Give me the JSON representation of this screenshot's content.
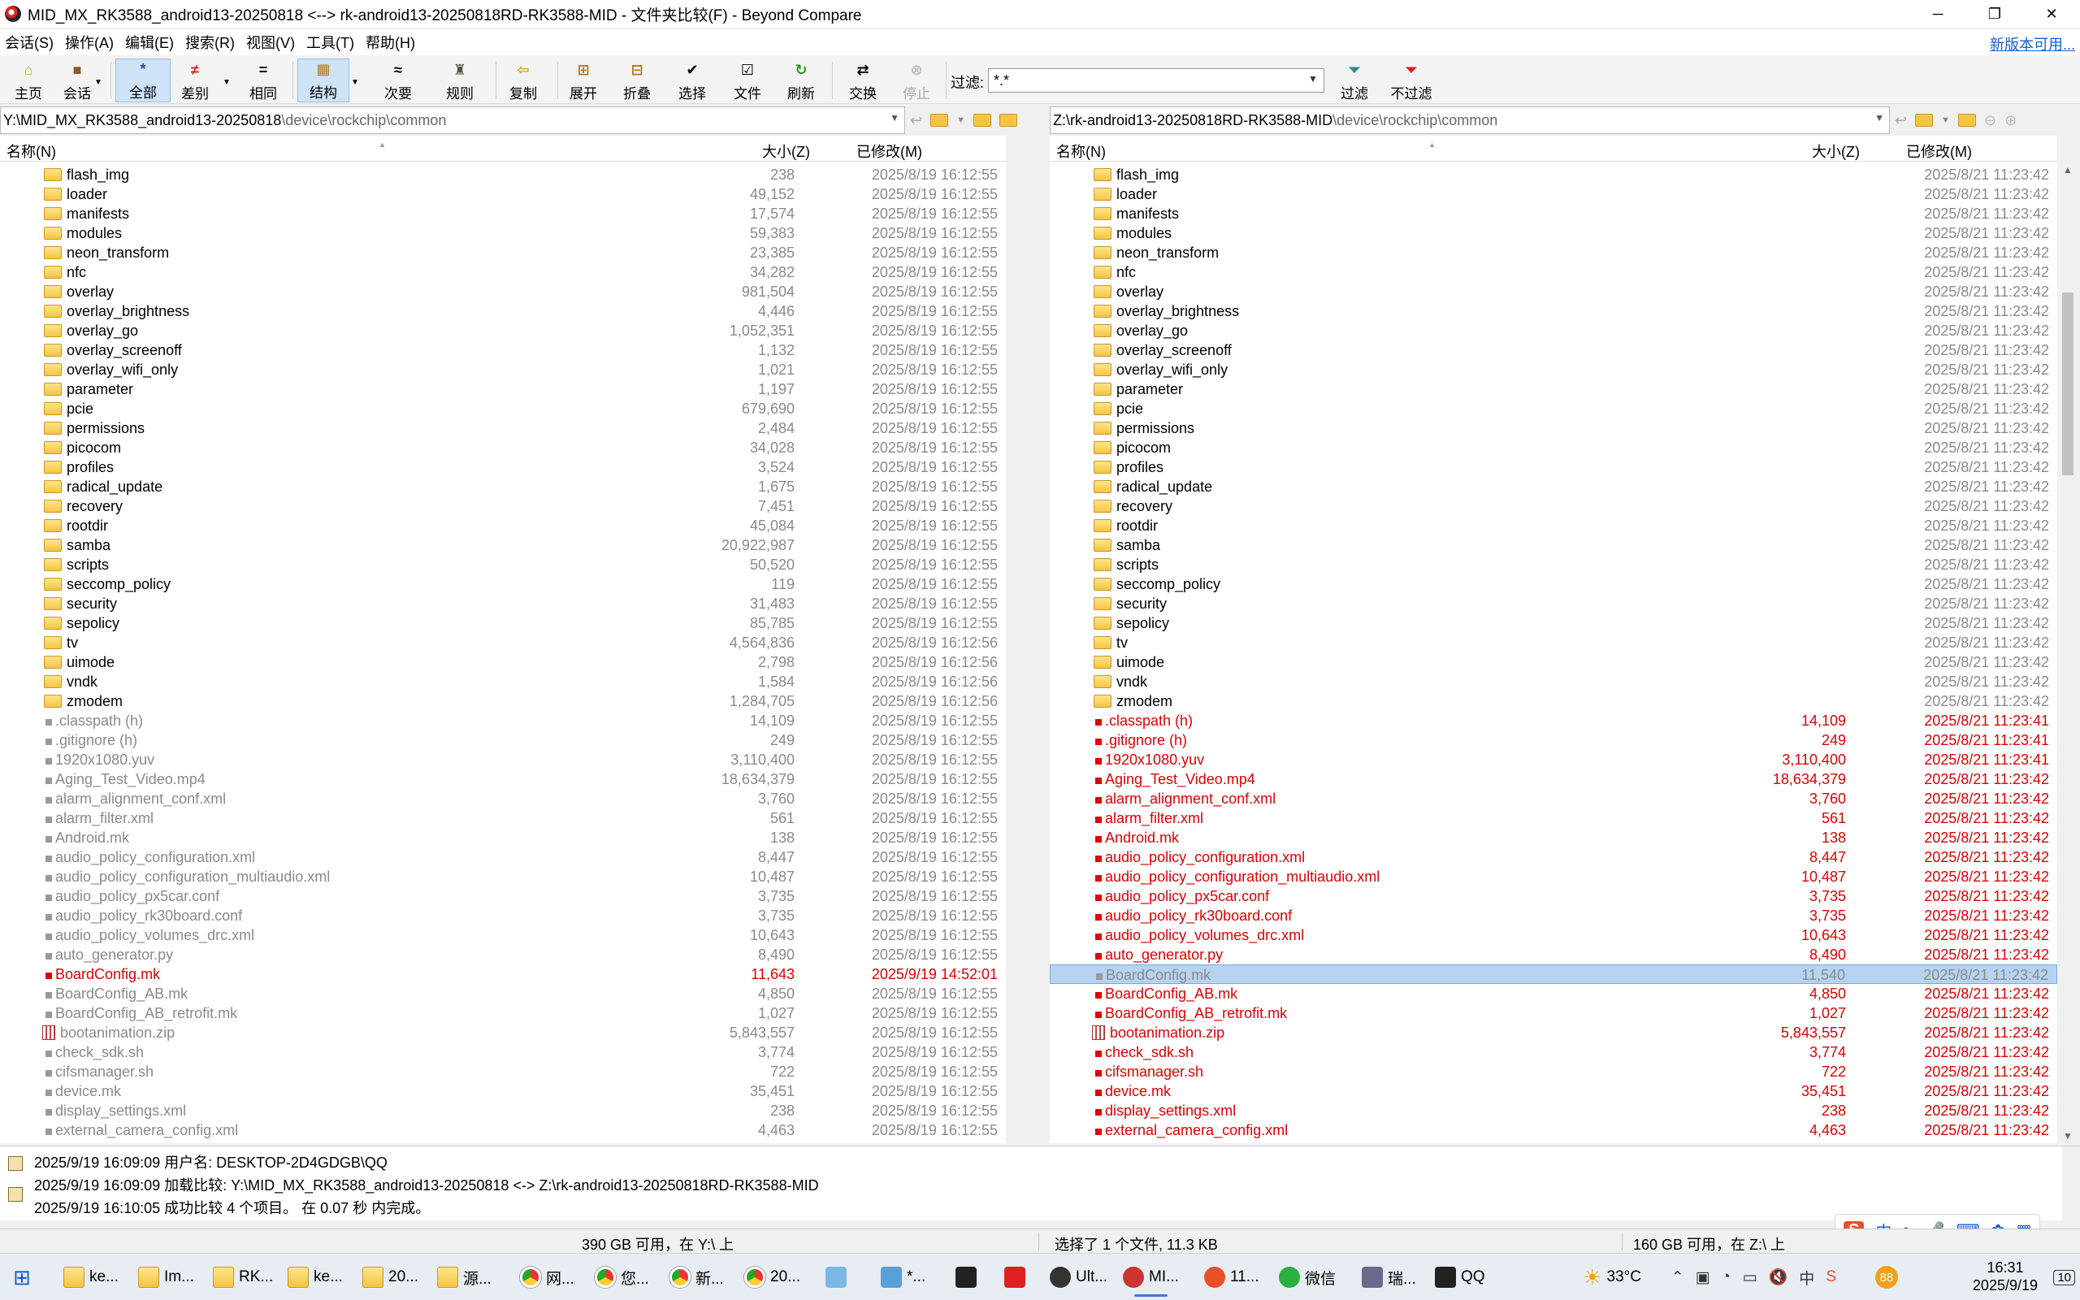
{
  "window": {
    "title": "MID_MX_RK3588_android13-20250818 <--> rk-android13-20250818RD-RK3588-MID - 文件夹比较(F) - Beyond Compare",
    "minimize": "─",
    "maximize": "❐",
    "close": "✕"
  },
  "menu": {
    "items": [
      "会话(S)",
      "操作(A)",
      "编辑(E)",
      "搜索(R)",
      "视图(V)",
      "工具(T)",
      "帮助(H)"
    ],
    "new_version": "新版本可用..."
  },
  "toolbar": {
    "home": "主页",
    "session": "会话",
    "all": "全部",
    "diffs": "差别",
    "same": "相同",
    "structure": "结构",
    "minor": "次要",
    "rules": "规则",
    "copy": "复制",
    "expand": "展开",
    "collapse": "折叠",
    "select": "选择",
    "files": "文件",
    "refresh": "刷新",
    "swap": "交换",
    "stop": "停止",
    "filter_label": "过滤:",
    "filter_value": "*.*",
    "filters": "过滤",
    "no_filter": "不过滤"
  },
  "left": {
    "path_main": "Y:\\MID_MX_RK3588_android13-20250818",
    "path_sub": "\\device\\rockchip\\common",
    "col_name": "名称(N)",
    "col_size": "大小(Z)",
    "col_modified": "已修改(M)"
  },
  "right": {
    "path_main": "Z:\\rk-android13-20250818RD-RK3588-MID",
    "path_sub": "\\device\\rockchip\\common",
    "col_name": "名称(N)",
    "col_size": "大小(Z)",
    "col_modified": "已修改(M)"
  },
  "rows": [
    {
      "name": "flash_img",
      "type": "folder",
      "lsize": "238",
      "ldate": "2025/8/19 16:12:55",
      "rsize": "",
      "rdate": "2025/8/21 11:23:42",
      "lstate": "same",
      "rstate": "same"
    },
    {
      "name": "loader",
      "type": "folder",
      "lsize": "49,152",
      "ldate": "2025/8/19 16:12:55",
      "rsize": "",
      "rdate": "2025/8/21 11:23:42",
      "lstate": "same",
      "rstate": "same"
    },
    {
      "name": "manifests",
      "type": "folder",
      "lsize": "17,574",
      "ldate": "2025/8/19 16:12:55",
      "rsize": "",
      "rdate": "2025/8/21 11:23:42",
      "lstate": "same",
      "rstate": "same"
    },
    {
      "name": "modules",
      "type": "folder",
      "lsize": "59,383",
      "ldate": "2025/8/19 16:12:55",
      "rsize": "",
      "rdate": "2025/8/21 11:23:42",
      "lstate": "same",
      "rstate": "same"
    },
    {
      "name": "neon_transform",
      "type": "folder",
      "lsize": "23,385",
      "ldate": "2025/8/19 16:12:55",
      "rsize": "",
      "rdate": "2025/8/21 11:23:42",
      "lstate": "same",
      "rstate": "same"
    },
    {
      "name": "nfc",
      "type": "folder",
      "lsize": "34,282",
      "ldate": "2025/8/19 16:12:55",
      "rsize": "",
      "rdate": "2025/8/21 11:23:42",
      "lstate": "same",
      "rstate": "same"
    },
    {
      "name": "overlay",
      "type": "folder",
      "lsize": "981,504",
      "ldate": "2025/8/19 16:12:55",
      "rsize": "",
      "rdate": "2025/8/21 11:23:42",
      "lstate": "same",
      "rstate": "same"
    },
    {
      "name": "overlay_brightness",
      "type": "folder",
      "lsize": "4,446",
      "ldate": "2025/8/19 16:12:55",
      "rsize": "",
      "rdate": "2025/8/21 11:23:42",
      "lstate": "same",
      "rstate": "same"
    },
    {
      "name": "overlay_go",
      "type": "folder",
      "lsize": "1,052,351",
      "ldate": "2025/8/19 16:12:55",
      "rsize": "",
      "rdate": "2025/8/21 11:23:42",
      "lstate": "same",
      "rstate": "same"
    },
    {
      "name": "overlay_screenoff",
      "type": "folder",
      "lsize": "1,132",
      "ldate": "2025/8/19 16:12:55",
      "rsize": "",
      "rdate": "2025/8/21 11:23:42",
      "lstate": "same",
      "rstate": "same"
    },
    {
      "name": "overlay_wifi_only",
      "type": "folder",
      "lsize": "1,021",
      "ldate": "2025/8/19 16:12:55",
      "rsize": "",
      "rdate": "2025/8/21 11:23:42",
      "lstate": "same",
      "rstate": "same"
    },
    {
      "name": "parameter",
      "type": "folder",
      "lsize": "1,197",
      "ldate": "2025/8/19 16:12:55",
      "rsize": "",
      "rdate": "2025/8/21 11:23:42",
      "lstate": "same",
      "rstate": "same"
    },
    {
      "name": "pcie",
      "type": "folder",
      "lsize": "679,690",
      "ldate": "2025/8/19 16:12:55",
      "rsize": "",
      "rdate": "2025/8/21 11:23:42",
      "lstate": "same",
      "rstate": "same"
    },
    {
      "name": "permissions",
      "type": "folder",
      "lsize": "2,484",
      "ldate": "2025/8/19 16:12:55",
      "rsize": "",
      "rdate": "2025/8/21 11:23:42",
      "lstate": "same",
      "rstate": "same"
    },
    {
      "name": "picocom",
      "type": "folder",
      "lsize": "34,028",
      "ldate": "2025/8/19 16:12:55",
      "rsize": "",
      "rdate": "2025/8/21 11:23:42",
      "lstate": "same",
      "rstate": "same"
    },
    {
      "name": "profiles",
      "type": "folder",
      "lsize": "3,524",
      "ldate": "2025/8/19 16:12:55",
      "rsize": "",
      "rdate": "2025/8/21 11:23:42",
      "lstate": "same",
      "rstate": "same"
    },
    {
      "name": "radical_update",
      "type": "folder",
      "lsize": "1,675",
      "ldate": "2025/8/19 16:12:55",
      "rsize": "",
      "rdate": "2025/8/21 11:23:42",
      "lstate": "same",
      "rstate": "same"
    },
    {
      "name": "recovery",
      "type": "folder",
      "lsize": "7,451",
      "ldate": "2025/8/19 16:12:55",
      "rsize": "",
      "rdate": "2025/8/21 11:23:42",
      "lstate": "same",
      "rstate": "same"
    },
    {
      "name": "rootdir",
      "type": "folder",
      "lsize": "45,084",
      "ldate": "2025/8/19 16:12:55",
      "rsize": "",
      "rdate": "2025/8/21 11:23:42",
      "lstate": "same",
      "rstate": "same"
    },
    {
      "name": "samba",
      "type": "folder",
      "lsize": "20,922,987",
      "ldate": "2025/8/19 16:12:55",
      "rsize": "",
      "rdate": "2025/8/21 11:23:42",
      "lstate": "same",
      "rstate": "same"
    },
    {
      "name": "scripts",
      "type": "folder",
      "lsize": "50,520",
      "ldate": "2025/8/19 16:12:55",
      "rsize": "",
      "rdate": "2025/8/21 11:23:42",
      "lstate": "same",
      "rstate": "same"
    },
    {
      "name": "seccomp_policy",
      "type": "folder",
      "lsize": "119",
      "ldate": "2025/8/19 16:12:55",
      "rsize": "",
      "rdate": "2025/8/21 11:23:42",
      "lstate": "same",
      "rstate": "same"
    },
    {
      "name": "security",
      "type": "folder",
      "lsize": "31,483",
      "ldate": "2025/8/19 16:12:55",
      "rsize": "",
      "rdate": "2025/8/21 11:23:42",
      "lstate": "same",
      "rstate": "same"
    },
    {
      "name": "sepolicy",
      "type": "folder",
      "lsize": "85,785",
      "ldate": "2025/8/19 16:12:55",
      "rsize": "",
      "rdate": "2025/8/21 11:23:42",
      "lstate": "same",
      "rstate": "same"
    },
    {
      "name": "tv",
      "type": "folder",
      "lsize": "4,564,836",
      "ldate": "2025/8/19 16:12:56",
      "rsize": "",
      "rdate": "2025/8/21 11:23:42",
      "lstate": "same",
      "rstate": "same"
    },
    {
      "name": "uimode",
      "type": "folder",
      "lsize": "2,798",
      "ldate": "2025/8/19 16:12:56",
      "rsize": "",
      "rdate": "2025/8/21 11:23:42",
      "lstate": "same",
      "rstate": "same"
    },
    {
      "name": "vndk",
      "type": "folder",
      "lsize": "1,584",
      "ldate": "2025/8/19 16:12:56",
      "rsize": "",
      "rdate": "2025/8/21 11:23:42",
      "lstate": "same",
      "rstate": "same"
    },
    {
      "name": "zmodem",
      "type": "folder",
      "lsize": "1,284,705",
      "ldate": "2025/8/19 16:12:56",
      "rsize": "",
      "rdate": "2025/8/21 11:23:42",
      "lstate": "same",
      "rstate": "same"
    },
    {
      "name": ".classpath (h)",
      "type": "file",
      "lsize": "14,109",
      "ldate": "2025/8/19 16:12:55",
      "rsize": "14,109",
      "rdate": "2025/8/21 11:23:41",
      "lstate": "gray",
      "rstate": "red"
    },
    {
      "name": ".gitignore (h)",
      "type": "file",
      "lsize": "249",
      "ldate": "2025/8/19 16:12:55",
      "rsize": "249",
      "rdate": "2025/8/21 11:23:41",
      "lstate": "gray",
      "rstate": "red"
    },
    {
      "name": "1920x1080.yuv",
      "type": "file",
      "lsize": "3,110,400",
      "ldate": "2025/8/19 16:12:55",
      "rsize": "3,110,400",
      "rdate": "2025/8/21 11:23:41",
      "lstate": "gray",
      "rstate": "red"
    },
    {
      "name": "Aging_Test_Video.mp4",
      "type": "file",
      "lsize": "18,634,379",
      "ldate": "2025/8/19 16:12:55",
      "rsize": "18,634,379",
      "rdate": "2025/8/21 11:23:42",
      "lstate": "gray",
      "rstate": "red"
    },
    {
      "name": "alarm_alignment_conf.xml",
      "type": "file",
      "lsize": "3,760",
      "ldate": "2025/8/19 16:12:55",
      "rsize": "3,760",
      "rdate": "2025/8/21 11:23:42",
      "lstate": "gray",
      "rstate": "red"
    },
    {
      "name": "alarm_filter.xml",
      "type": "file",
      "lsize": "561",
      "ldate": "2025/8/19 16:12:55",
      "rsize": "561",
      "rdate": "2025/8/21 11:23:42",
      "lstate": "gray",
      "rstate": "red"
    },
    {
      "name": "Android.mk",
      "type": "file",
      "lsize": "138",
      "ldate": "2025/8/19 16:12:55",
      "rsize": "138",
      "rdate": "2025/8/21 11:23:42",
      "lstate": "gray",
      "rstate": "red"
    },
    {
      "name": "audio_policy_configuration.xml",
      "type": "file",
      "lsize": "8,447",
      "ldate": "2025/8/19 16:12:55",
      "rsize": "8,447",
      "rdate": "2025/8/21 11:23:42",
      "lstate": "gray",
      "rstate": "red"
    },
    {
      "name": "audio_policy_configuration_multiaudio.xml",
      "type": "file",
      "lsize": "10,487",
      "ldate": "2025/8/19 16:12:55",
      "rsize": "10,487",
      "rdate": "2025/8/21 11:23:42",
      "lstate": "gray",
      "rstate": "red"
    },
    {
      "name": "audio_policy_px5car.conf",
      "type": "file",
      "lsize": "3,735",
      "ldate": "2025/8/19 16:12:55",
      "rsize": "3,735",
      "rdate": "2025/8/21 11:23:42",
      "lstate": "gray",
      "rstate": "red"
    },
    {
      "name": "audio_policy_rk30board.conf",
      "type": "file",
      "lsize": "3,735",
      "ldate": "2025/8/19 16:12:55",
      "rsize": "3,735",
      "rdate": "2025/8/21 11:23:42",
      "lstate": "gray",
      "rstate": "red"
    },
    {
      "name": "audio_policy_volumes_drc.xml",
      "type": "file",
      "lsize": "10,643",
      "ldate": "2025/8/19 16:12:55",
      "rsize": "10,643",
      "rdate": "2025/8/21 11:23:42",
      "lstate": "gray",
      "rstate": "red"
    },
    {
      "name": "auto_generator.py",
      "type": "file",
      "lsize": "8,490",
      "ldate": "2025/8/19 16:12:55",
      "rsize": "8,490",
      "rdate": "2025/8/21 11:23:42",
      "lstate": "gray",
      "rstate": "red"
    },
    {
      "name": "BoardConfig.mk",
      "type": "file",
      "lsize": "11,643",
      "ldate": "2025/9/19 14:52:01",
      "rsize": "11,540",
      "rdate": "2025/8/21 11:23:42",
      "lstate": "red",
      "rstate": "sel"
    },
    {
      "name": "BoardConfig_AB.mk",
      "type": "file",
      "lsize": "4,850",
      "ldate": "2025/8/19 16:12:55",
      "rsize": "4,850",
      "rdate": "2025/8/21 11:23:42",
      "lstate": "gray",
      "rstate": "red"
    },
    {
      "name": "BoardConfig_AB_retrofit.mk",
      "type": "file",
      "lsize": "1,027",
      "ldate": "2025/8/19 16:12:55",
      "rsize": "1,027",
      "rdate": "2025/8/21 11:23:42",
      "lstate": "gray",
      "rstate": "red"
    },
    {
      "name": "bootanimation.zip",
      "type": "zip",
      "lsize": "5,843,557",
      "ldate": "2025/8/19 16:12:55",
      "rsize": "5,843,557",
      "rdate": "2025/8/21 11:23:42",
      "lstate": "gray",
      "rstate": "red"
    },
    {
      "name": "check_sdk.sh",
      "type": "file",
      "lsize": "3,774",
      "ldate": "2025/8/19 16:12:55",
      "rsize": "3,774",
      "rdate": "2025/8/21 11:23:42",
      "lstate": "gray",
      "rstate": "red"
    },
    {
      "name": "cifsmanager.sh",
      "type": "file",
      "lsize": "722",
      "ldate": "2025/8/19 16:12:55",
      "rsize": "722",
      "rdate": "2025/8/21 11:23:42",
      "lstate": "gray",
      "rstate": "red"
    },
    {
      "name": "device.mk",
      "type": "file",
      "lsize": "35,451",
      "ldate": "2025/8/19 16:12:55",
      "rsize": "35,451",
      "rdate": "2025/8/21 11:23:42",
      "lstate": "gray",
      "rstate": "red"
    },
    {
      "name": "display_settings.xml",
      "type": "file",
      "lsize": "238",
      "ldate": "2025/8/19 16:12:55",
      "rsize": "238",
      "rdate": "2025/8/21 11:23:42",
      "lstate": "gray",
      "rstate": "red"
    },
    {
      "name": "external_camera_config.xml",
      "type": "file",
      "lsize": "4,463",
      "ldate": "2025/8/19 16:12:55",
      "rsize": "4,463",
      "rdate": "2025/8/21 11:23:42",
      "lstate": "gray",
      "rstate": "red"
    }
  ],
  "log": [
    "2025/9/19 16:09:09  用户名: DESKTOP-2D4GDGB\\QQ",
    "2025/9/19 16:09:09  加载比较: Y:\\MID_MX_RK3588_android13-20250818 <-> Z:\\rk-android13-20250818RD-RK3588-MID",
    "2025/9/19 16:10:05  成功比较 4 个项目。 在 0.07 秒 内完成。"
  ],
  "status": {
    "left_free": "390 GB 可用，在 Y:\\ 上",
    "selection": "选择了 1 个文件, 11.3 KB",
    "right_free": "160 GB 可用，在 Z:\\ 上"
  },
  "taskbar": {
    "items": [
      {
        "label": "ke...",
        "icon": "folder-icon"
      },
      {
        "label": "Im...",
        "icon": "folder-icon"
      },
      {
        "label": "RK...",
        "icon": "folder-icon"
      },
      {
        "label": "ke...",
        "icon": "folder-icon"
      },
      {
        "label": "20...",
        "icon": "folder-icon"
      },
      {
        "label": "源...",
        "icon": "folder-icon"
      },
      {
        "label": "网...",
        "icon": "chrome-icon"
      },
      {
        "label": "您...",
        "icon": "chrome-icon"
      },
      {
        "label": "新...",
        "icon": "chrome-icon"
      },
      {
        "label": "20...",
        "icon": "chrome-icon"
      },
      {
        "label": "",
        "icon": "paint-icon"
      },
      {
        "label": "*...",
        "icon": "notepad-icon"
      },
      {
        "label": "",
        "icon": "terminal-icon"
      },
      {
        "label": "",
        "icon": "wps-icon"
      },
      {
        "label": "Ult...",
        "icon": "ultraedit-icon"
      },
      {
        "label": "MI...",
        "icon": "beyondcompare-icon"
      },
      {
        "label": "11...",
        "icon": "app-icon"
      },
      {
        "label": "微信",
        "icon": "wechat-icon"
      },
      {
        "label": "瑞...",
        "icon": "tool-icon"
      },
      {
        "label": "QQ",
        "icon": "qq-icon"
      }
    ],
    "weather": "33°C",
    "badge": "88",
    "ime": "中",
    "time": "16:31",
    "date": "2025/9/19",
    "notifications": "10"
  },
  "colors": {
    "diff_red": "#e00000",
    "same_gray": "#8a8a8a",
    "selection": "#b6d3f2",
    "link_blue": "#1a5fd0"
  }
}
